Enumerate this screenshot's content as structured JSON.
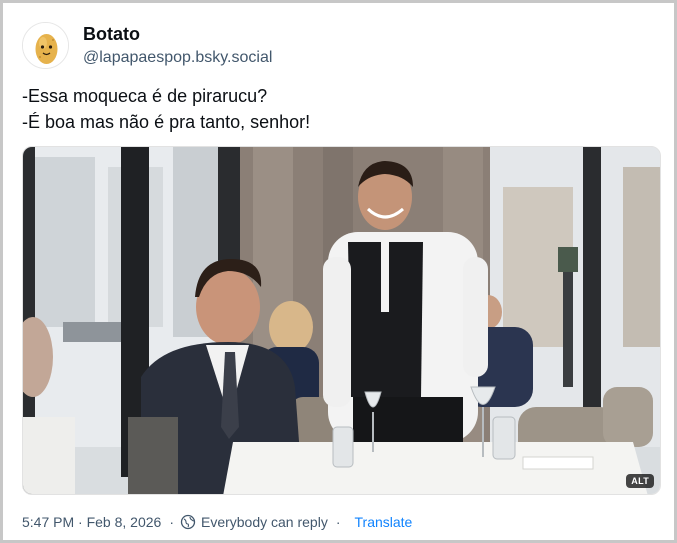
{
  "post": {
    "author": {
      "display_name": "Botato",
      "handle": "@lapapaespop.bsky.social",
      "avatar_icon": "potato-avatar-icon"
    },
    "text_lines": [
      "-Essa moqueca é de pirarucu?",
      "-É boa mas não é pra tanto, senhor!"
    ],
    "image": {
      "alt_badge": "ALT"
    },
    "footer": {
      "timestamp": "5:47 PM · Feb 8, 2026",
      "reply_setting": "Everybody can reply",
      "separator": "·",
      "translate_label": "Translate"
    }
  },
  "colors": {
    "text_primary": "#0b0f14",
    "text_secondary": "#42576c",
    "link": "#1083fe",
    "frame_border": "#c7c7c7"
  }
}
